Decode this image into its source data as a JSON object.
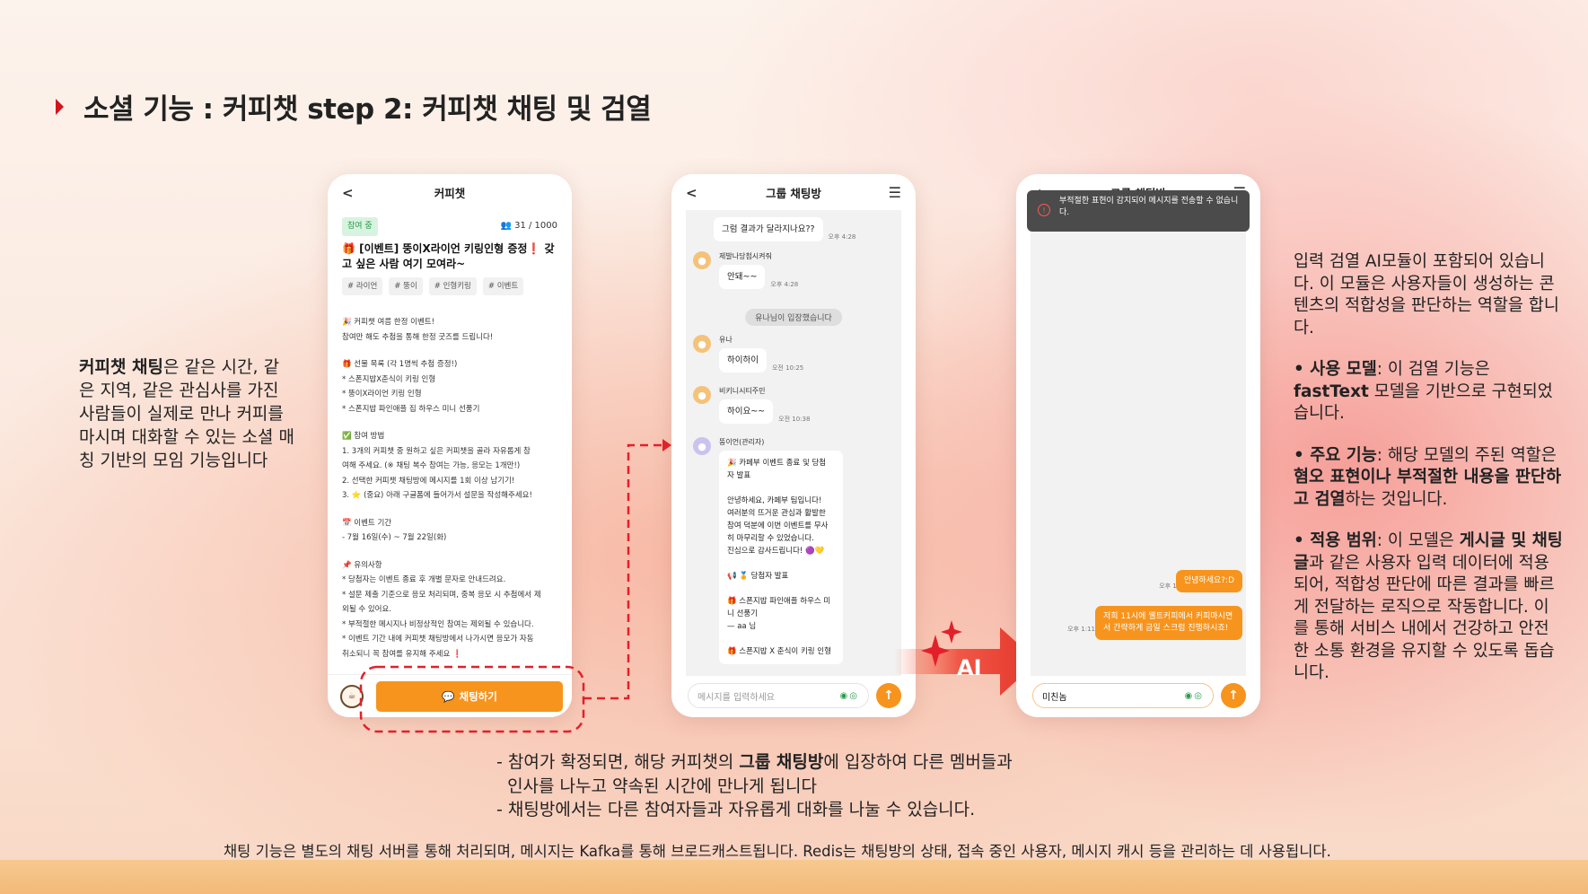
{
  "title": "소셜 기능 : 커피챗 step 2: 커피챗 채팅 및 검열",
  "left_text": {
    "bold": "커피챗 채팅",
    "rest": "은 같은 시간, 같은 지역, 같은 관심사를 가진 사람들이 실제로 만나 커피를 마시며 대화할 수 있는 소셜 매칭 기반의 모임 기능입니다"
  },
  "phone1": {
    "header": "커피챗",
    "badge": "참여 중",
    "count": "31 / 1000",
    "event_title": "🎁 [이벤트] 뚱이X라이언 키링인형 증정❗ 갖고 싶은 사람 여기 모여라~",
    "tags": [
      "# 라이언",
      "# 뚱이",
      "# 인형키링",
      "# 이벤트"
    ],
    "sections": [
      [
        "🎉 커피챗 여름 한정 이벤트!",
        "참여만 해도 추첨을 통해 한정 굿즈를 드립니다!"
      ],
      [
        "🎁 선물 목록 (각 1명씩 추첨 증정!)",
        "* 스폰지밥X춘식이 키링 인형",
        "* 뚱이X라이언 키링 인형",
        "* 스폰지밥 파인애플 집 하우스 미니 선풍기"
      ],
      [
        "✅ 참여 방법",
        "1. 3개의 커피챗 중 원하고 싶은 커피챗을 골라 자유롭게 참",
        "여해 주세요. (※ 채팅 복수 참여는 가능, 응모는 1개만!)",
        "2. 선택한 커피챗 채팅방에 메시지를 1회 이상 남기기!",
        "3. ⭐ (중요) 아래 구글폼에 들어가서 설문을 작성해주세요!"
      ],
      [
        "📅 이벤트 기간",
        "- 7월 16일(수) ~ 7월 22일(화)"
      ],
      [
        "📌 유의사항",
        "* 당첨자는 이벤트 종료 후 개별 문자로 안내드려요.",
        "* 설문 제출 기준으로 응모 처리되며, 중복 응모 시 추첨에서 제",
        "외될 수 있어요.",
        "* 부적절한 메시지나 비정상적인 참여는 제외될 수 있습니다.",
        "* 이벤트 기간 내에 커피챗 채팅방에서 나가시면 응모가 자동",
        "취소되니 꼭 참여를 유지해 주세요 ❗"
      ]
    ],
    "button": "채팅하기"
  },
  "phone2": {
    "header": "그룹 채팅방",
    "messages": [
      {
        "text": "그럼 결과가 달라지나요??",
        "time": "오후 4:28"
      },
      {
        "name": "제발나당첨시켜줘",
        "text": "안돼~~",
        "time": "오후 4:28"
      },
      {
        "system": "유나님이 입장했습니다"
      },
      {
        "name": "유나",
        "text": "하이하이",
        "time": "오전 10:25"
      },
      {
        "name": "비키니시티주민",
        "text": "하이요~~",
        "time": "오전 10:38"
      },
      {
        "name": "뚱이언(관리자)",
        "lines": [
          "🎉 카페부 이벤트 종료 및 당첨",
          "자 발표",
          "",
          "안녕하세요, 카페부 팀입니다!",
          "여러분의 뜨거운 관심과 활발한",
          "참여 덕분에 이번 이벤트를 무사",
          "히 마무리할 수 있었습니다.",
          "진심으로 감사드립니다! 🟣💛",
          "",
          "📢 🏅 당첨자 발표",
          "",
          "🎁 스폰지밥 파인애플 하우스 미",
          "니 선풍기",
          "  — aa 님",
          "",
          "🎁 스폰지밥 X 춘식이 키링 인형"
        ]
      }
    ],
    "placeholder": "메시지를 입력하세요"
  },
  "phone3": {
    "header": "그룹 채팅방",
    "toast": "부적절한 표현이 감지되어 메시지를 전송할 수 없습니다.",
    "my_messages": [
      {
        "text": "안녕하세요?:D",
        "time": "오후 1:10"
      },
      {
        "text": "저희 11시에 웰트커피에서 커피마시면서 간략하게 금일 스크럼 진행하시죠!",
        "time": "오후 1:11"
      }
    ],
    "input_value": "미친놈"
  },
  "ai_label": "AI",
  "right_text": {
    "intro": "입력 검열 AI모듈이 포함되어 있습니다. 이 모듈은 사용자들이 생성하는 콘텐츠의 적합성을 판단하는 역할을 합니다.",
    "model_label": "• 사용 모델",
    "model_a": ": 이 검열 기능은 ",
    "model_b": "fastText",
    "model_c": " 모델을 기반으로 구현되었습니다.",
    "func_label": "• 주요 기능",
    "func_a": ": 해당 모델의 주된 역할은 ",
    "func_b": "혐오 표현이나 부적절한 내용을 판단하고 검열",
    "func_c": "하는 것입니다.",
    "scope_label": "• 적용 범위",
    "scope_a": ": 이 모델은 ",
    "scope_b": "게시글 및 채팅글",
    "scope_c": "과 같은 사용자 입력 데이터에 적용되어, 적합성 판단에 따른 결과를 빠르게 전달하는 로직으로 작동합니다. 이를 통해 서비스 내에서 건강하고 안전한 소통 환경을 유지할 수 있도록 돕습니다."
  },
  "bullets": {
    "l1a": "- 참여가 확정되면, 해당 커피챗의 ",
    "l1b": "그룹 채팅방",
    "l1c": "에 입장하여 다른 멤버들과",
    "l2": "  인사를 나누고 약속된 시간에 만나게 됩니다",
    "l3": "- 채팅방에서는 다른 참여자들과 자유롭게 대화를 나눌 수 있습니다."
  },
  "footer": "채팅 기능은 별도의 채팅 서버를 통해 처리되며, 메시지는 Kafka를 통해 브로드캐스트됩니다. Redis는 채팅방의 상태, 접속 중인 사용자, 메시지 캐시 등을 관리하는 데 사용됩니다."
}
